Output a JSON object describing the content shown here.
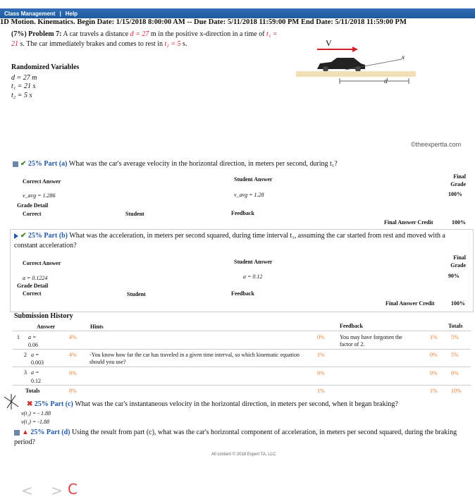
{
  "menu": {
    "class_management": "Class Management",
    "separator": "|",
    "help": "Help"
  },
  "header": {
    "text": "1D Motion. Kinematics. Begin Date: 1/15/2018 8:00:00 AM -- Due Date: 5/11/2018 11:59:00 PM End Date: 5/11/2018 11:59:00 PM"
  },
  "problem": {
    "label": "(7%) Problem 7:",
    "text1": "A car travels a distance",
    "d_eq": "d = 27",
    "text2": "m in the positive x-direction in a time of",
    "t1_eq": "t₁ = 21",
    "text3": "s. The car immediately brakes and comes to rest in",
    "t2_eq": "t₂ = 5",
    "text4": "s."
  },
  "randomized": {
    "title": "Randomized Variables",
    "d": "d = 27 m",
    "t1": "t₁ = 21 s",
    "t2": "t₂ = 5 s"
  },
  "figure": {
    "v_label": "V",
    "x_label": "x",
    "d_label": "d"
  },
  "watermark": "©theexpertta.com",
  "part_a": {
    "pct": "25%",
    "label": "Part (a)",
    "question": "What was the car's average velocity in the horizontal direction, in meters per second, during t₁?",
    "correct_hdr": "Correct Answer",
    "student_hdr": "Student Answer",
    "final_grade_hdr": "Final Grade",
    "correct": "v_avg = 1.286",
    "student": "v_avg = 1.28",
    "grade": "100%",
    "grade_detail": "Grade Detail",
    "col_correct": "Correct",
    "col_student": "Student",
    "col_feedback": "Feedback",
    "final_credit_label": "Final Answer Credit",
    "final_credit": "100%"
  },
  "part_b": {
    "pct": "25%",
    "label": "Part (b)",
    "question": "What was the acceleration, in meters per second squared, during time interval t₁, assuming the car started from rest and moved with a constant acceleration?",
    "correct_hdr": "Correct Answer",
    "student_hdr": "Student Answer",
    "final_grade_hdr": "Final Grade",
    "correct": "a = 0.1224",
    "student": "a = 0.12",
    "grade": "90%",
    "grade_detail": "Grade Detail",
    "col_correct": "Correct",
    "col_student": "Student",
    "col_feedback": "Feedback",
    "final_credit_label": "Final Answer Credit",
    "final_credit": "100%"
  },
  "history": {
    "title": "Submission History",
    "headers": {
      "answer": "Answer",
      "hints": "Hints",
      "feedback": "Feedback",
      "totals": "Totals"
    },
    "rows": [
      {
        "n": "1",
        "ans1": "a =",
        "ans2": "0.06",
        "hint_pct": "4%",
        "hint": "",
        "pct2": "0%",
        "feedback": "You may have forgotten the factor of 2.",
        "pct3": "1%",
        "total": "5%"
      },
      {
        "n": "2",
        "ans1": "a =",
        "ans2": "0.003",
        "hint_pct": "4%",
        "hint": "-You know how far the car has traveled in a given time interval, so which kinematic equation should you use?",
        "pct2": "1%",
        "feedback": "",
        "pct3": "0%",
        "total": "5%"
      },
      {
        "n": "3",
        "ans1": "a =",
        "ans2": "0.12",
        "hint_pct": "0%",
        "hint": "",
        "pct2": "0%",
        "feedback": "",
        "pct3": "0%",
        "total": "0%"
      }
    ],
    "totals_label": "Totals",
    "totals": {
      "hints": "8%",
      "pct2": "1%",
      "pct3": "1%",
      "total": "10%"
    }
  },
  "part_c": {
    "pct": "25%",
    "label": "Part (c)",
    "question": "What was the car's instantaneous velocity in the horizontal direction, in meters per second, when it began braking?",
    "ans1": "v(t₁) = - 1.88",
    "ans2": "v(t₁) = -1.88"
  },
  "part_d": {
    "pct": "25%",
    "label": "Part (d)",
    "question": "Using the result from part (c), what was the car's horizontal component of acceleration, in meters per second squared, during the braking period?"
  },
  "footer": "All content © 2018 Expert TA, LLC",
  "browser": {
    "back": "<",
    "forward": ">",
    "reload": "C"
  }
}
